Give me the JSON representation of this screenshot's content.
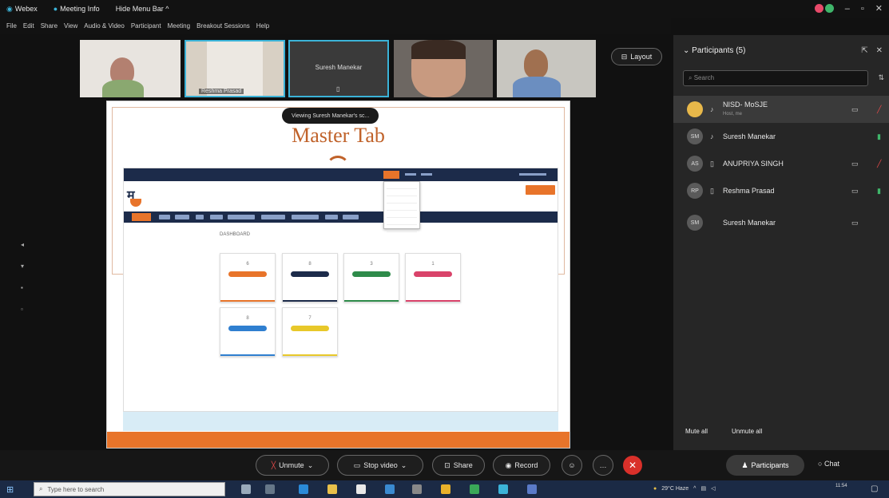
{
  "titlebar": {
    "app_name": "Webex",
    "meeting_info": "Meeting Info",
    "hide_menu": "Hide Menu Bar ^"
  },
  "menu": [
    "File",
    "Edit",
    "Share",
    "View",
    "Audio & Video",
    "Participant",
    "Meeting",
    "Breakout Sessions",
    "Help"
  ],
  "video_tiles": [
    {
      "name": ""
    },
    {
      "name": "Reshma Prasad"
    },
    {
      "name": "Suresh Manekar"
    },
    {
      "name": ""
    },
    {
      "name": ""
    }
  ],
  "layout_label": "Layout",
  "viewing_label": "Viewing Suresh Manekar's sc...",
  "slide": {
    "title": "Master Tab",
    "dashboard_label": "DASHBOARD",
    "cards": [
      {
        "num": "6",
        "color": "#e8742a"
      },
      {
        "num": "8",
        "color": "#1c2b4a"
      },
      {
        "num": "3",
        "color": "#2e8b4a"
      },
      {
        "num": "1",
        "color": "#d9436a"
      },
      {
        "num": "8",
        "color": "#2f7fd0"
      },
      {
        "num": "7",
        "color": "#e8c82a"
      }
    ]
  },
  "participants": {
    "header": "Participants (5)",
    "search_placeholder": "Search",
    "list": [
      {
        "initials": "",
        "name": "NISD- MoSJE",
        "sub": "Host, me"
      },
      {
        "initials": "SM",
        "name": "Suresh Manekar",
        "sub": ""
      },
      {
        "initials": "AS",
        "name": "ANUPRIYA SINGH",
        "sub": ""
      },
      {
        "initials": "RP",
        "name": "Reshma Prasad",
        "sub": ""
      },
      {
        "initials": "SM",
        "name": "Suresh Manekar",
        "sub": ""
      }
    ],
    "mute_all": "Mute all",
    "unmute_all": "Unmute all"
  },
  "controls": {
    "unmute": "Unmute",
    "stop_video": "Stop video",
    "share": "Share",
    "record": "Record",
    "participants": "Participants",
    "chat": "Chat"
  },
  "taskbar": {
    "search_placeholder": "Type here to search",
    "weather": "29°C Haze",
    "time": "11:54"
  },
  "colors": {
    "accent": "#e8742a",
    "navy": "#1c2b4a",
    "end_call": "#d9302a"
  }
}
